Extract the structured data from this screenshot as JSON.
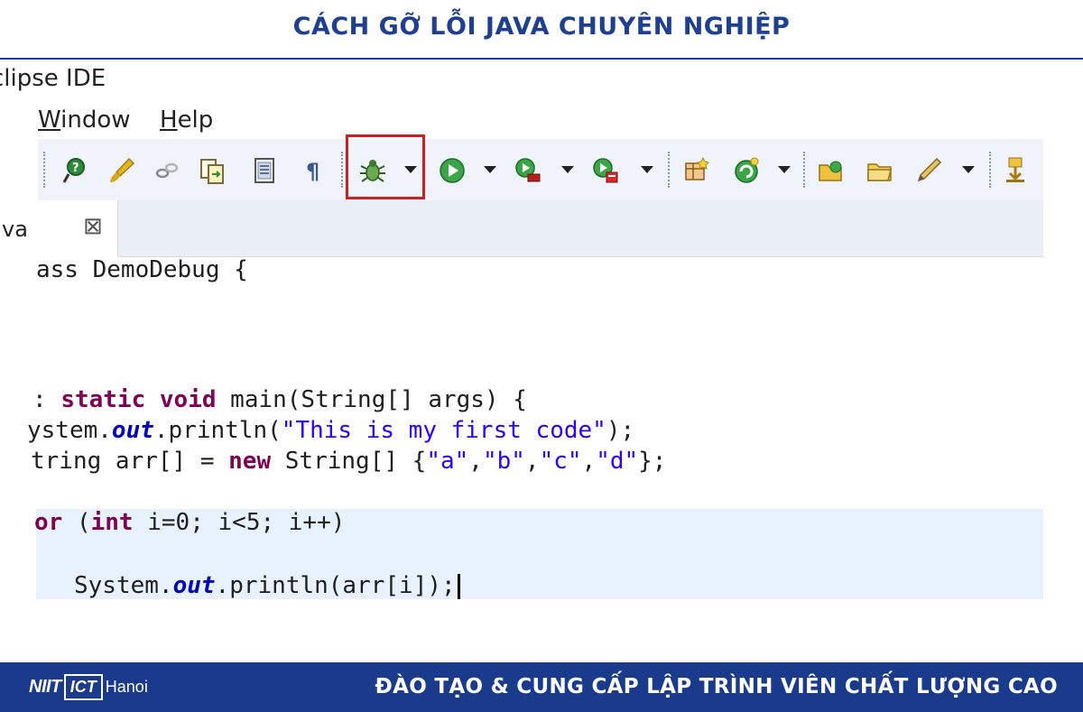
{
  "header": {
    "title": "CÁCH GỠ LỖI JAVA CHUYÊN NGHIỆP"
  },
  "ide": {
    "window_title": "clipse IDE",
    "menu": [
      {
        "label": "Window"
      },
      {
        "label": "Help"
      }
    ],
    "toolbar": {
      "icons": [
        "help-pin-icon",
        "brush-icon",
        "link-icon",
        "copy-icon",
        "document-icon",
        "pilcrow-icon",
        "debug-bug-icon",
        "run-icon",
        "coverage-run-icon",
        "external-tools-icon",
        "new-class-icon",
        "refresh-icon",
        "open-folder-icon",
        "folder-icon",
        "pencil-icon",
        "next-annotation-icon"
      ],
      "highlighted": "debug-bug-icon",
      "highlight_color": "#cc1f1f"
    },
    "editor_tab": {
      "label": "va",
      "close_glyph": "⊠"
    },
    "code_lines": [
      "ass DemoDebug {",
      "",
      ": static void main(String[] args) {",
      "ystem.out.println(\"This is my first code\");",
      "tring arr[] = new String[] {\"a\",\"b\",\"c\",\"d\"};",
      "",
      "or (int i=0; i<5; i++)",
      "",
      "    System.out.println(arr[i]);"
    ]
  },
  "footer": {
    "logo": {
      "niit": "NIIT",
      "ict": "ICT",
      "city": "Hanoi"
    },
    "slogan": "ĐÀO TẠO & CUNG CẤP LẬP TRÌNH VIÊN CHẤT LƯỢNG CAO"
  },
  "colors": {
    "brand_blue": "#1a3a8c",
    "title_blue": "#1f3f8f",
    "keyword": "#7f0055",
    "string": "#2a00ff",
    "field": "#0000c0",
    "current_line": "#e8f2fe"
  }
}
